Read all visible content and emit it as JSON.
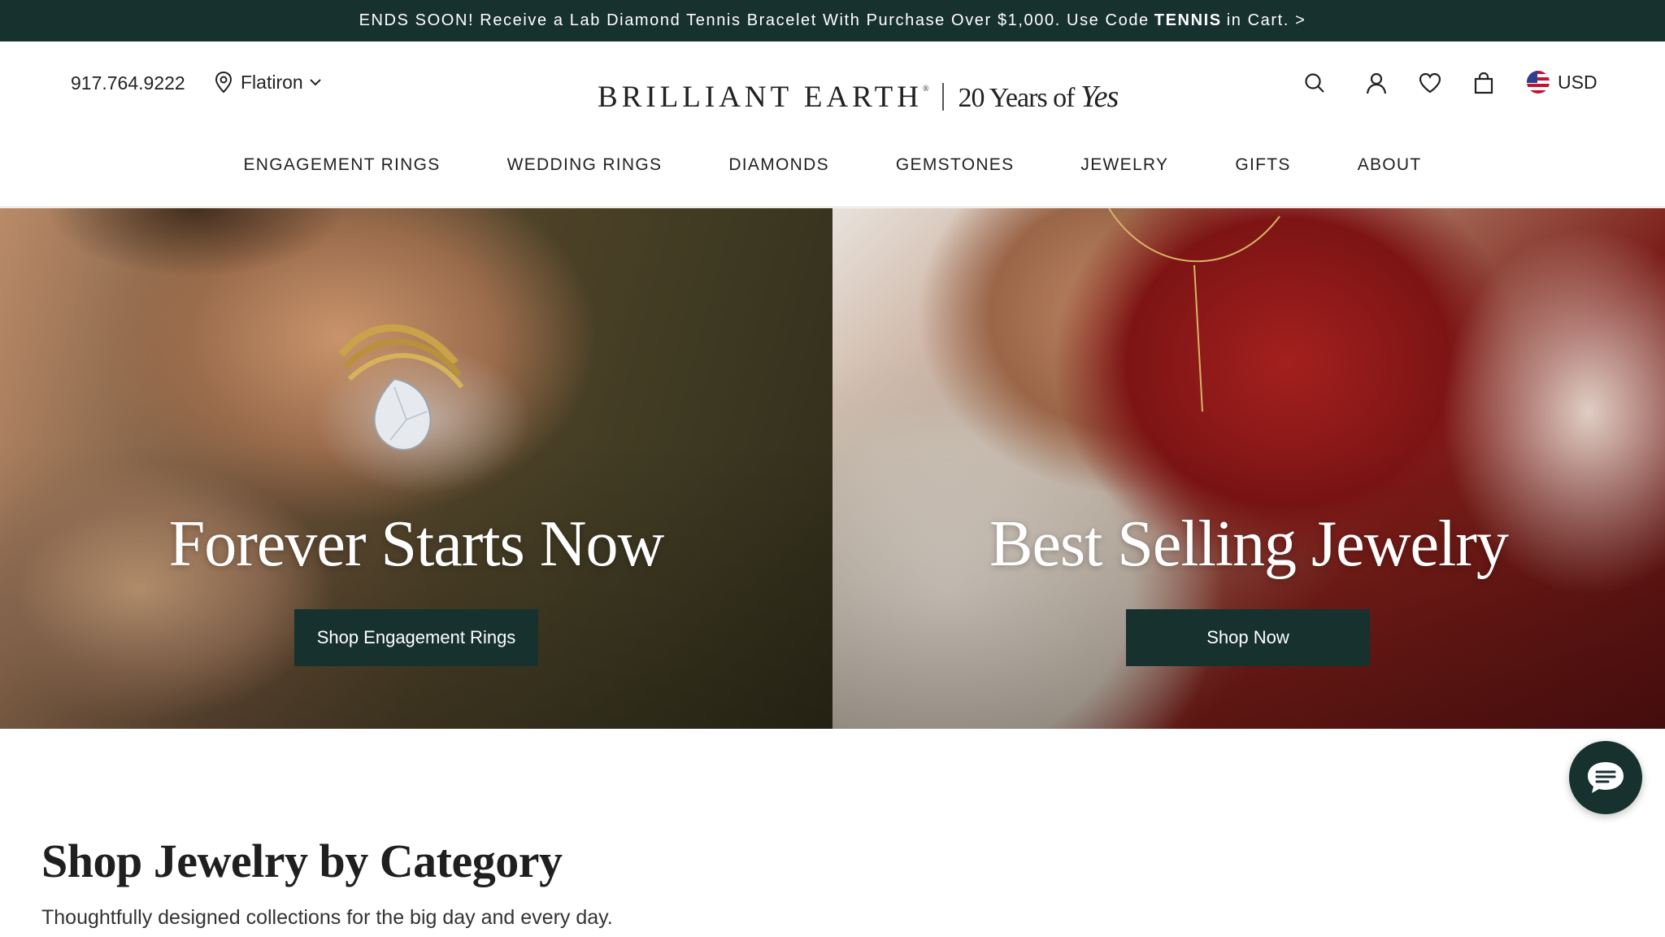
{
  "promo": {
    "text_before": "ENDS SOON! Receive a Lab Diamond Tennis Bracelet With Purchase Over $1,000. Use Code",
    "code": "TENNIS",
    "text_after": "in Cart. >"
  },
  "header": {
    "phone": "917.764.9222",
    "location": "Flatiron",
    "logo_brand": "BRILLIANT EARTH",
    "logo_reg": "®",
    "logo_tagline": "20 Years of",
    "logo_tagline_script": "Yes",
    "currency": "USD",
    "icons": [
      "search-icon",
      "account-icon",
      "heart-icon",
      "bag-icon",
      "us-flag-icon"
    ]
  },
  "nav": {
    "items": [
      {
        "label": "ENGAGEMENT RINGS"
      },
      {
        "label": "WEDDING RINGS"
      },
      {
        "label": "DIAMONDS"
      },
      {
        "label": "GEMSTONES"
      },
      {
        "label": "JEWELRY"
      },
      {
        "label": "GIFTS"
      },
      {
        "label": "ABOUT"
      }
    ]
  },
  "hero": {
    "left": {
      "title": "Forever Starts Now",
      "button": "Shop Engagement Rings"
    },
    "right": {
      "title": "Best Selling Jewelry",
      "button": "Shop Now"
    }
  },
  "category": {
    "title": "Shop Jewelry by Category",
    "subtitle": "Thoughtfully designed collections for the big day and every day."
  },
  "colors": {
    "brand_dark": "#17312f",
    "white": "#ffffff",
    "text": "#1f1f1f"
  },
  "chat": {
    "icon": "chat-icon"
  }
}
